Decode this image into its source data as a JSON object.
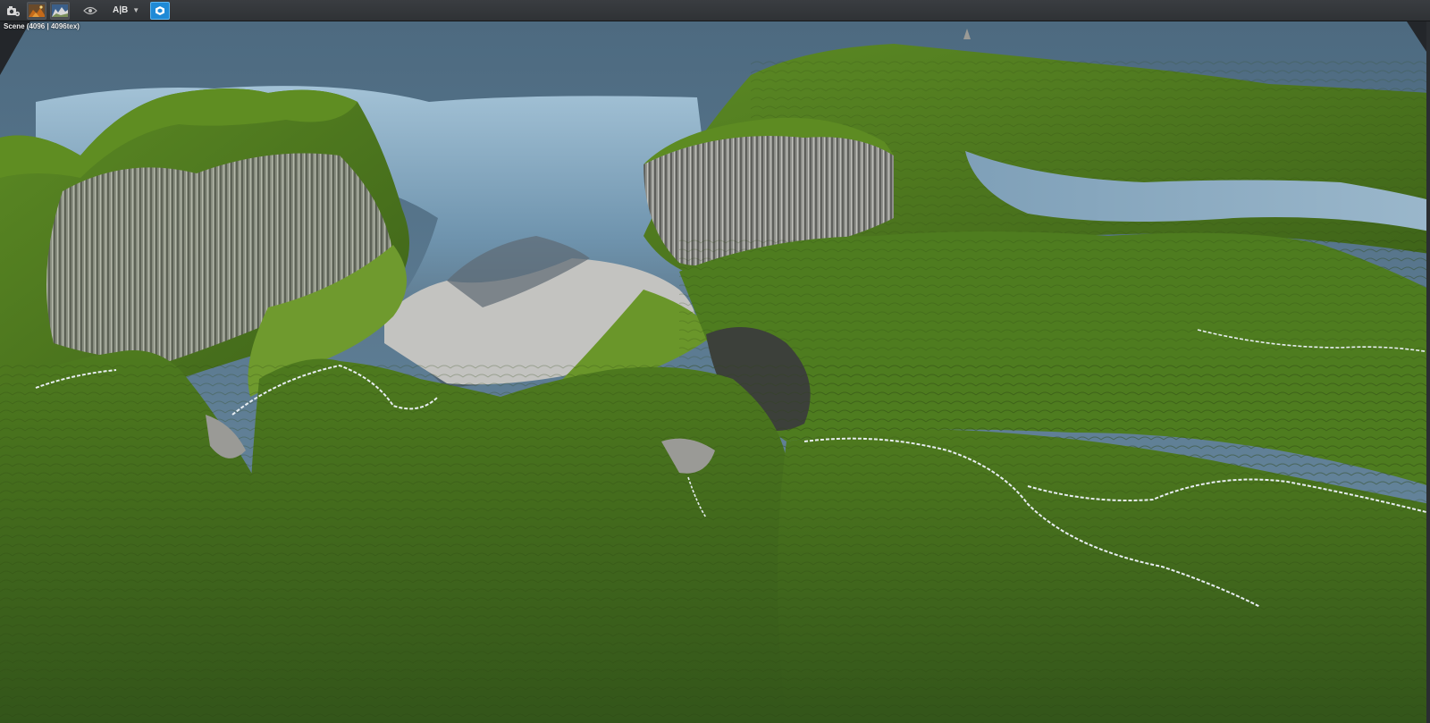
{
  "toolbar": {
    "buttons": [
      {
        "name": "camera-settings",
        "icon": "camera-gear-icon"
      },
      {
        "name": "render-preview",
        "icon": "render-thumbnail-icon"
      },
      {
        "name": "terrain-preview",
        "icon": "terrain-thumbnail-icon"
      },
      {
        "name": "visibility",
        "icon": "eye-icon"
      },
      {
        "name": "view-mode",
        "icon": "cube-view-icon",
        "active": true
      }
    ],
    "ab_label": "A|B",
    "ab_caret": "▼"
  },
  "viewport": {
    "label": "Scene (4096 | 4096tex)"
  },
  "colors": {
    "toolbar_bg": "#34373b",
    "accent": "#1f8ad6",
    "sky": "#5b7a90",
    "grass_light": "#6f9a2e",
    "grass_dark": "#2f4a12",
    "rock": "#9a9a96",
    "snow": "#c9c9c6",
    "glacier": "#8fb1c8"
  }
}
